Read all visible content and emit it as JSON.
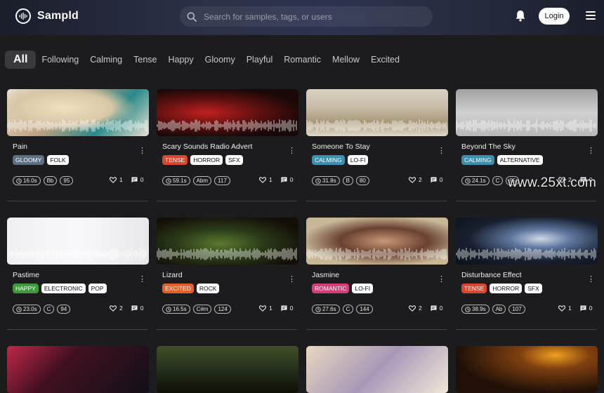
{
  "app": {
    "name": "Sampld"
  },
  "search": {
    "placeholder": "Search for samples, tags, or users"
  },
  "header": {
    "login_label": "Login"
  },
  "moods": [
    "All",
    "Following",
    "Calming",
    "Tense",
    "Happy",
    "Gloomy",
    "Playful",
    "Romantic",
    "Mellow",
    "Excited"
  ],
  "mood_colors": {
    "GLOOMY": "#5d6f80",
    "TENSE": "#d9472f",
    "CALMING": "#3a8fb0",
    "HAPPY": "#3f9a3a",
    "EXCITED": "#e0612a",
    "ROMANTIC": "#d33d7a"
  },
  "cards": [
    {
      "title": "Pain",
      "mood": "GLOOMY",
      "tags": [
        "FOLK"
      ],
      "duration": "16.0s",
      "key": "Bb",
      "bpm": "95",
      "likes": "1",
      "comments": "0",
      "thumb": "comic"
    },
    {
      "title": "Scary Sounds Radio Advert",
      "mood": "TENSE",
      "tags": [
        "HORROR",
        "SFX"
      ],
      "duration": "59.1s",
      "key": "Abm",
      "bpm": "117",
      "likes": "1",
      "comments": "0",
      "thumb": "tunnel"
    },
    {
      "title": "Someone To Stay",
      "mood": "CALMING",
      "tags": [
        "LO-FI"
      ],
      "duration": "31.8s",
      "key": "B",
      "bpm": "80",
      "likes": "2",
      "comments": "0",
      "thumb": "field"
    },
    {
      "title": "Beyond The Sky",
      "mood": "CALMING",
      "tags": [
        "ALTERNATIVE"
      ],
      "duration": "24.1s",
      "key": "C",
      "bpm": "95",
      "likes": "2",
      "comments": "0",
      "thumb": "sky"
    },
    {
      "title": "Pastime",
      "mood": "HAPPY",
      "tags": [
        "ELECTRONIC",
        "POP"
      ],
      "duration": "23.0s",
      "key": "C",
      "bpm": "94",
      "likes": "2",
      "comments": "0",
      "thumb": "yarn"
    },
    {
      "title": "Lizard",
      "mood": "EXCITED",
      "tags": [
        "ROCK"
      ],
      "duration": "16.5s",
      "key": "C#m",
      "bpm": "124",
      "likes": "1",
      "comments": "0",
      "thumb": "lizard"
    },
    {
      "title": "Jasmine",
      "mood": "ROMANTIC",
      "tags": [
        "LO-FI"
      ],
      "duration": "27.6s",
      "key": "C",
      "bpm": "144",
      "likes": "2",
      "comments": "0",
      "thumb": "portrait"
    },
    {
      "title": "Disturbance Effect",
      "mood": "TENSE",
      "tags": [
        "HORROR",
        "SFX"
      ],
      "duration": "38.9s",
      "key": "Ab",
      "bpm": "107",
      "likes": "1",
      "comments": "0",
      "thumb": "smoke"
    },
    {
      "title": "",
      "mood": "",
      "tags": [],
      "duration": "",
      "key": "",
      "bpm": "",
      "likes": "",
      "comments": "",
      "thumb": "concert"
    },
    {
      "title": "",
      "mood": "",
      "tags": [],
      "duration": "",
      "key": "",
      "bpm": "",
      "likes": "",
      "comments": "",
      "thumb": "forest"
    },
    {
      "title": "",
      "mood": "",
      "tags": [],
      "duration": "",
      "key": "",
      "bpm": "",
      "likes": "",
      "comments": "",
      "thumb": "flowers"
    },
    {
      "title": "",
      "mood": "",
      "tags": [],
      "duration": "",
      "key": "",
      "bpm": "",
      "likes": "",
      "comments": "",
      "thumb": "cafe"
    }
  ],
  "watermark": "www.25xt.com"
}
